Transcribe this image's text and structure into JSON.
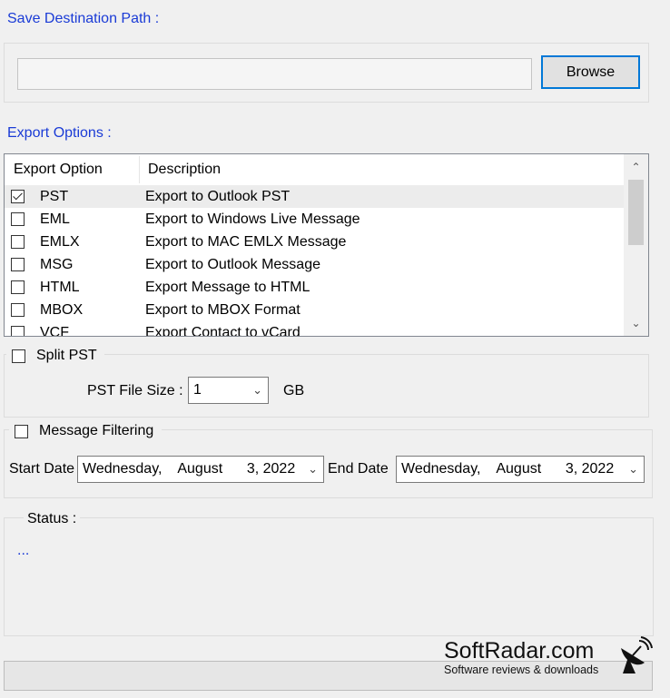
{
  "destination": {
    "label": "Save Destination Path :",
    "path_value": "",
    "browse_label": "Browse"
  },
  "export_options": {
    "label": "Export Options :",
    "columns": [
      "Export Option",
      "Description"
    ],
    "rows": [
      {
        "option": "PST",
        "description": "Export to Outlook PST",
        "checked": true
      },
      {
        "option": "EML",
        "description": "Export to Windows Live Message",
        "checked": false
      },
      {
        "option": "EMLX",
        "description": "Export to MAC EMLX Message",
        "checked": false
      },
      {
        "option": "MSG",
        "description": "Export to Outlook Message",
        "checked": false
      },
      {
        "option": "HTML",
        "description": "Export Message to HTML",
        "checked": false
      },
      {
        "option": "MBOX",
        "description": "Export to MBOX Format",
        "checked": false
      },
      {
        "option": "VCF",
        "description": "Export Contact to vCard",
        "checked": false
      }
    ]
  },
  "split_pst": {
    "label": "Split PST",
    "file_size_label": "PST File Size :",
    "file_size_value": "1",
    "unit": "GB"
  },
  "message_filtering": {
    "label": "Message Filtering",
    "start_label": "Start Date",
    "start_value": "Wednesday,    August      3, 2022",
    "end_label": "End Date",
    "end_value": "Wednesday,    August      3, 2022"
  },
  "status": {
    "label": "Status :",
    "text": "..."
  },
  "watermark": {
    "title": "SoftRadar.com",
    "subtitle": "Software reviews & downloads"
  },
  "colors": {
    "accent_blue": "#1a3bd6",
    "button_border": "#0078d7",
    "background": "#f0f0f0"
  }
}
